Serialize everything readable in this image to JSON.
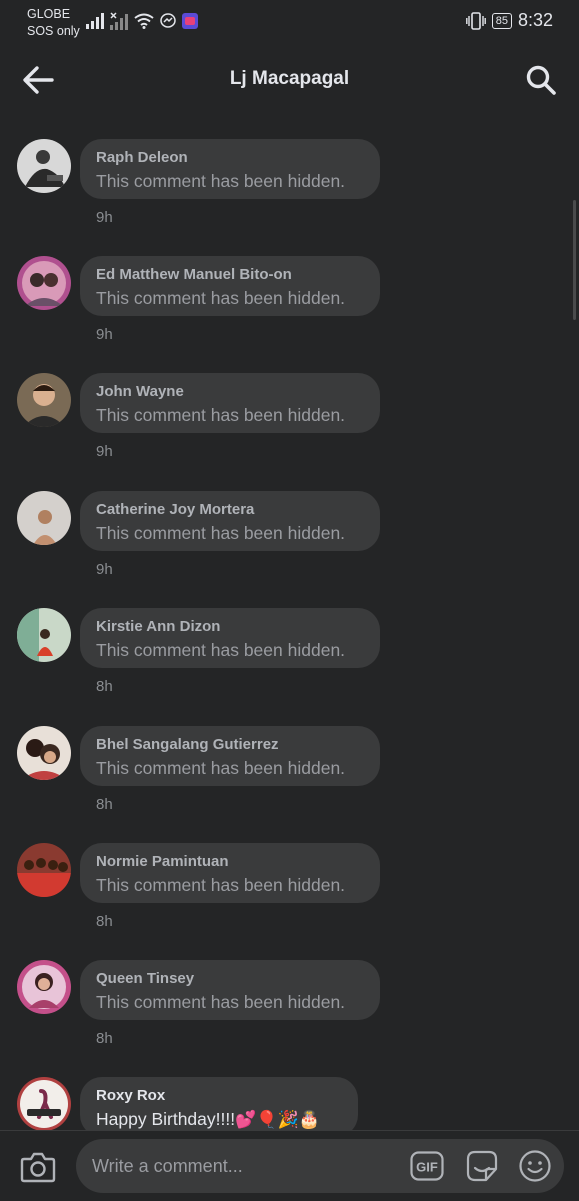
{
  "status_bar": {
    "carrier_line1": "GLOBE",
    "carrier_line2": "SOS only",
    "battery": "85",
    "time": "8:32"
  },
  "header": {
    "title": "Lj Macapagal",
    "back_icon": "back-arrow-icon",
    "search_icon": "search-icon"
  },
  "comments": [
    {
      "author": "Raph Deleon",
      "text": "This comment has been hidden.",
      "time": "9h",
      "avatar_color": "#6b6b6b"
    },
    {
      "author": "Ed Matthew Manuel Bito-on",
      "text": "This comment has been hidden.",
      "time": "9h",
      "avatar_color": "#a04a86"
    },
    {
      "author": "John Wayne",
      "text": "This comment has been hidden.",
      "time": "9h",
      "avatar_color": "#5a4a3a"
    },
    {
      "author": "Catherine Joy Mortera",
      "text": "This comment has been hidden.",
      "time": "9h",
      "avatar_color": "#c9c4bd"
    },
    {
      "author": "Kirstie Ann Dizon",
      "text": "This comment has been hidden.",
      "time": "8h",
      "avatar_color": "#8fb59a"
    },
    {
      "author": "Bhel Sangalang Gutierrez",
      "text": "This comment has been hidden.",
      "time": "8h",
      "avatar_color": "#a08070"
    },
    {
      "author": "Normie Pamintuan",
      "text": "This comment has been hidden.",
      "time": "8h",
      "avatar_color": "#b04038"
    },
    {
      "author": "Queen Tinsey",
      "text": "This comment has been hidden.",
      "time": "8h",
      "avatar_color": "#c0508a"
    },
    {
      "author": "Roxy Rox",
      "text": "Happy Birthday!!!!",
      "emoji": "💕🎈🎉🎂",
      "time": "",
      "avatar_color": "#e8e4e0"
    }
  ],
  "composer": {
    "placeholder": "Write a comment...",
    "gif_label": "GIF",
    "camera_icon": "camera-icon",
    "sticker_icon": "sticker-icon",
    "emoji_icon": "emoji-icon"
  },
  "colors": {
    "background": "#242526",
    "bubble": "#3a3b3c",
    "text_primary": "#e4e6eb",
    "text_muted": "#9a9ca1"
  }
}
